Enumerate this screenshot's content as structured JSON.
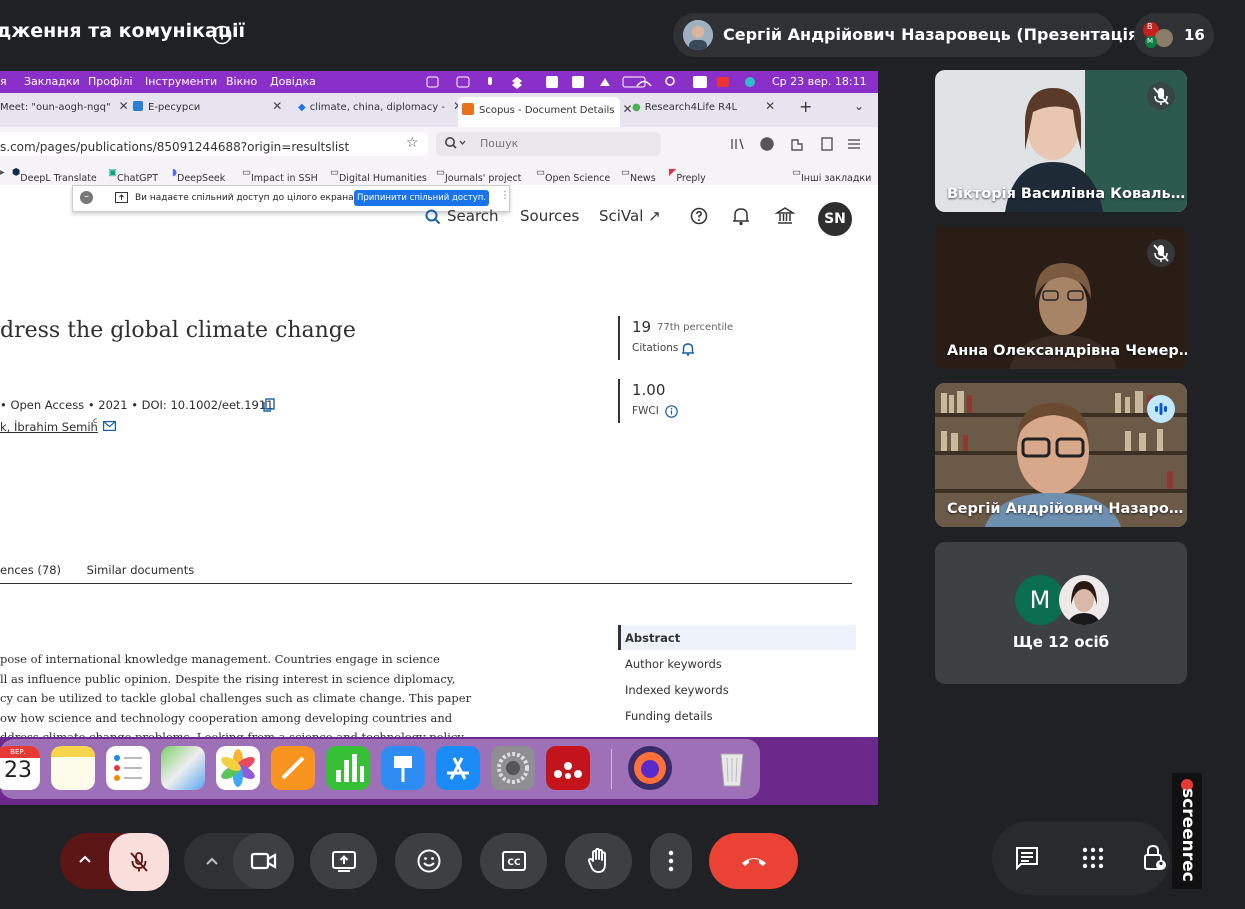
{
  "meeting": {
    "title": "дження та комунікації",
    "presenter_chip": "Сергій Андрійович Назаровець (Презентація)",
    "participants_count": "16",
    "participant_avatar_letters": [
      "B",
      "M"
    ]
  },
  "shared_screen": {
    "menu_items": [
      "я",
      "Закладки",
      "Профілі",
      "Інструменти",
      "Вікно",
      "Довідка"
    ],
    "menu_clock": "Ср 23 вер.  18:11",
    "tabs": [
      {
        "label": "Meet: \"oun-aogh-ngq\"",
        "active": false
      },
      {
        "label": "E-ресурси",
        "active": false
      },
      {
        "label": "climate, china, diplomacy -",
        "active": false
      },
      {
        "label": "Scopus - Document Details",
        "active": true
      },
      {
        "label": "Research4Life R4L",
        "active": false
      }
    ],
    "url": "s.com/pages/publications/85091244688?origin=resultslist",
    "search_placeholder": "Пошук",
    "bookmarks": [
      "DeepL Translate",
      "ChatGPT",
      "DeepSeek",
      "Impact in SSH",
      "Digital Humanities",
      "Journals' project",
      "Open Science",
      "News",
      "Preply"
    ],
    "bookmarks_other": "Інші закладки",
    "share_banner": {
      "text": "Ви надаєте спільний доступ до цілого екрана.",
      "stop_button": "Припинити спільний доступ."
    },
    "scopus": {
      "nav": [
        "Search",
        "Sources",
        "SciVal ↗"
      ],
      "user_initials": "SN",
      "doc_title": "dress the global climate change",
      "meta": "•  Open Access  •  2021  •  DOI: 10.1002/eet.1911",
      "author": "k, İbrahim Semih",
      "author_sup": "c",
      "citations_value": "19",
      "citations_percentile": "77th percentile",
      "citations_label": "Citations",
      "fwci_value": "1.00",
      "fwci_label": "FWCI",
      "tab_references": "ences (78)",
      "tab_similar": "Similar documents",
      "toc": [
        "Abstract",
        "Author keywords",
        "Indexed keywords",
        "Funding details"
      ],
      "abstract_lines": [
        "pose of international knowledge management. Countries engage in science",
        "ll as influence public opinion. Despite the rising interest in science diplomacy,",
        "cy can be utilized to tackle global challenges such as climate change. This paper",
        "ow how science and technology cooperation among developing countries and",
        "ddress climate change problems. Looking from a science and technology policy"
      ]
    },
    "dock": {
      "calendar_month": "ВЕР.",
      "calendar_day": "23"
    }
  },
  "participants": [
    {
      "name": "Вікторія Василівна Коваль…",
      "muted": true
    },
    {
      "name": "Анна Олександрівна Чемер…",
      "muted": true
    },
    {
      "name": "Сергій Андрійович Назаро…",
      "muted": false,
      "speaking": true
    }
  ],
  "more_participants": {
    "avatar_letter": "M",
    "label": "Ще 12 осіб"
  },
  "watermark": "screenrec",
  "colors": {
    "meet_bg": "#202124",
    "end_call": "#ea4335",
    "speaking_border": "#a8c7fa",
    "mac_menu": "#8b2fc9"
  }
}
